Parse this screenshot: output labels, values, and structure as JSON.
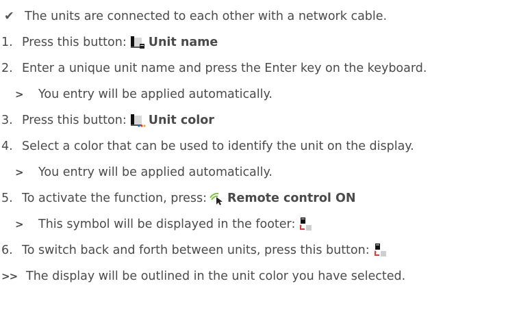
{
  "items": [
    {
      "marker": "✔",
      "text": "The units are connected to each other with a network cable."
    },
    {
      "marker": "1.",
      "text": "Press this button: ",
      "icon": "unit-name-icon",
      "bold": "Unit name"
    },
    {
      "marker": "2.",
      "text": "Enter a unique unit name and press the Enter key on the keyboard."
    },
    {
      "marker": ">",
      "text": "You entry will be applied automatically."
    },
    {
      "marker": "3.",
      "text": "Press this button: ",
      "icon": "unit-color-icon",
      "bold": "Unit color"
    },
    {
      "marker": "4.",
      "text": "Select a color that can be used to identify the unit on the display."
    },
    {
      "marker": ">",
      "text": "You entry will be applied automatically."
    },
    {
      "marker": "5.",
      "text": "To activate the function, press:",
      "icon": "remote-control-icon",
      "bold": "Remote control ON"
    },
    {
      "marker": ">",
      "text": "This symbol will be displayed in the footer: ",
      "icon": "switch-unit-icon"
    },
    {
      "marker": "6.",
      "text": "To switch back and forth between units, press this button: ",
      "icon": "switch-unit-icon"
    },
    {
      "marker": ">>",
      "text": "The display will be outlined in the unit color you have selected."
    }
  ]
}
